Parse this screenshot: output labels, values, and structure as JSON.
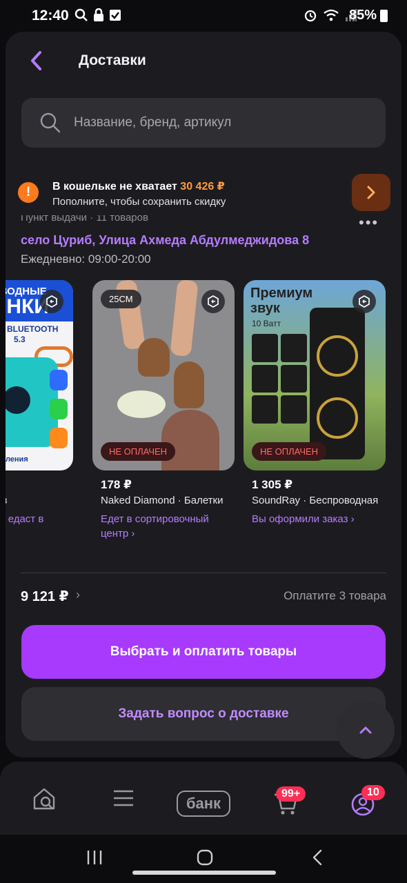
{
  "status_bar": {
    "time": "12:40",
    "battery": "85%",
    "icons": [
      "search-icon",
      "lock-icon",
      "checkbox-icon",
      "alarm-icon",
      "wifi-icon",
      "signal-icon",
      "battery-icon"
    ]
  },
  "header": {
    "title": "Доставки",
    "back_icon": "chevron-left-icon"
  },
  "search": {
    "placeholder": "Название, бренд, артикул"
  },
  "wallet_alert": {
    "title": "В кошельке не хватает",
    "amount": "30 426 ₽",
    "subtitle": "Пополните, чтобы сохранить скидку"
  },
  "delivery": {
    "pickup_label": "Пункт выдачи · 11 товаров",
    "address": "село Цуриб, Улица Ахмеда Абдулмеджидова 8",
    "hours": "Ежедневно: 09:00-20:00"
  },
  "products": [
    {
      "price": "",
      "name": "онка портатив",
      "status": "собрал заказ: едаст в",
      "image_text_top": "ОВОДНЫЕ",
      "image_text_main": "ОНКИ",
      "image_text_bt": "BLUETOOTH",
      "image_text_ver": "5.3",
      "image_text_bottom": "светления"
    },
    {
      "price": "178 ₽",
      "name": "Naked Diamond · Балетки",
      "status": "Едет в сортировочный центр ›",
      "size_badge": "25СМ",
      "unpaid_badge": "НЕ ОПЛАЧЕН"
    },
    {
      "price": "1 305 ₽",
      "name": "SoundRay · Беспроводная",
      "status": "Вы оформили заказ ›",
      "unpaid_badge": "НЕ ОПЛАЧЕН",
      "image_text_main": "Премиум звук",
      "image_text_watt": "10 Ватт"
    }
  ],
  "summary": {
    "total": "9 121 ₽",
    "pay_count": "Оплатите 3 товара"
  },
  "buttons": {
    "primary": "Выбрать и оплатить товары",
    "secondary": "Задать вопрос о доставке"
  },
  "bottom_nav": {
    "bank_label": "банк",
    "cart_badge": "99+",
    "profile_badge": "10"
  },
  "colors": {
    "accent": "#a73afd",
    "link": "#b67cff",
    "warning": "#ff7a1c",
    "badge": "#ff2e54"
  }
}
